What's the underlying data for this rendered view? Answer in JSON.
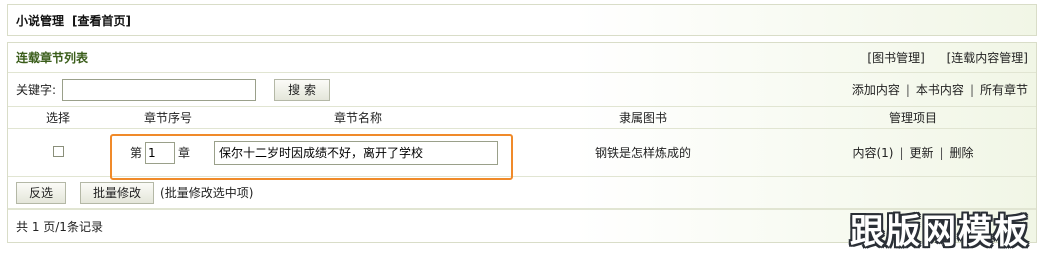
{
  "header": {
    "title": "小说管理",
    "view_home": "[查看首页]"
  },
  "panel": {
    "title": "连载章节列表",
    "link_books": "[图书管理]",
    "link_content": "[连载内容管理]"
  },
  "search": {
    "label": "关键字:",
    "value": "",
    "button": "搜 索",
    "links": [
      "添加内容",
      "本书内容",
      "所有章节"
    ]
  },
  "table": {
    "headers": [
      "选择",
      "章节序号",
      "章节名称",
      "隶属图书",
      "管理项目"
    ],
    "rows": [
      {
        "checked": false,
        "prefix": "第",
        "number": "1",
        "suffix": "章",
        "name": "保尔十二岁时因成绩不好，离开了学校",
        "book": "钢铁是怎样炼成的",
        "actions": [
          "内容(1)",
          "更新",
          "删除"
        ]
      }
    ]
  },
  "actions": {
    "invert": "反选",
    "batch": "批量修改",
    "note": "(批量修改选中项)"
  },
  "footer": {
    "summary": "共 1 页/1条记录"
  },
  "watermark": "跟版网模板",
  "colors": {
    "accent": "#3a5d1a",
    "highlight": "#f08a2a"
  }
}
